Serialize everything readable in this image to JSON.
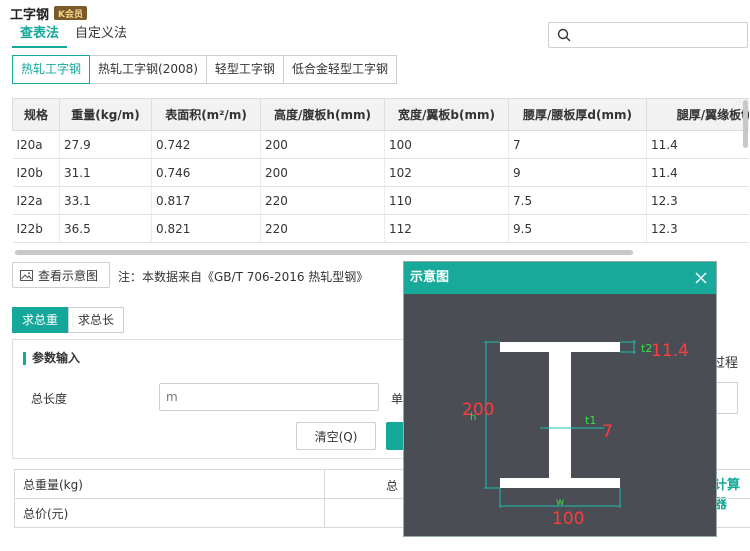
{
  "header": {
    "title": "工字钢",
    "badge": "K会员"
  },
  "mode_tabs": [
    "查表法",
    "自定义法"
  ],
  "search": {
    "placeholder": ""
  },
  "type_tabs": [
    "热轧工字钢",
    "热轧工字钢(2008)",
    "轻型工字钢",
    "低合金轻型工字钢"
  ],
  "table": {
    "columns": [
      "规格",
      "重量(kg/m)",
      "表面积(m²/m)",
      "高度/腹板h(mm)",
      "宽度/翼板b(mm)",
      "腰厚/腰板厚d(mm)",
      "腿厚/翼缘板t("
    ],
    "rows": [
      [
        "I20a",
        "27.9",
        "0.742",
        "200",
        "100",
        "7",
        "11.4"
      ],
      [
        "I20b",
        "31.1",
        "0.746",
        "200",
        "102",
        "9",
        "11.4"
      ],
      [
        "I22a",
        "33.1",
        "0.817",
        "220",
        "110",
        "7.5",
        "12.3"
      ],
      [
        "I22b",
        "36.5",
        "0.821",
        "220",
        "112",
        "9.5",
        "12.3"
      ]
    ]
  },
  "diagram_button": "查看示意图",
  "source_note": "注：本数据来自《GB/T 706-2016 热轧型钢》",
  "calc_tabs": [
    "求总重",
    "求总长"
  ],
  "params": {
    "header": "参数输入",
    "length_label": "总长度",
    "length_placeholder": "m",
    "price_label": "单",
    "clear_button": "清空(Q)"
  },
  "right_panel": {
    "process_label": "过程",
    "calculator_link": "计算器"
  },
  "results": {
    "weight_label": "总重量(kg)",
    "price_label": "总价(元)",
    "right_label": "总"
  },
  "popup": {
    "title": "示意图",
    "dims": {
      "t2_label": "t2",
      "t2_value": "11.4",
      "h_label": "h",
      "h_value": "200",
      "t1_label": "t1",
      "t1_value": "7",
      "w_label": "w",
      "w_value": "100"
    }
  },
  "colors": {
    "accent": "#14a89a",
    "dim_line": "#19c0b0",
    "dim_value": "#ff3b3b",
    "dim_label": "#35e04a",
    "popup_bg": "#4b4d55"
  }
}
